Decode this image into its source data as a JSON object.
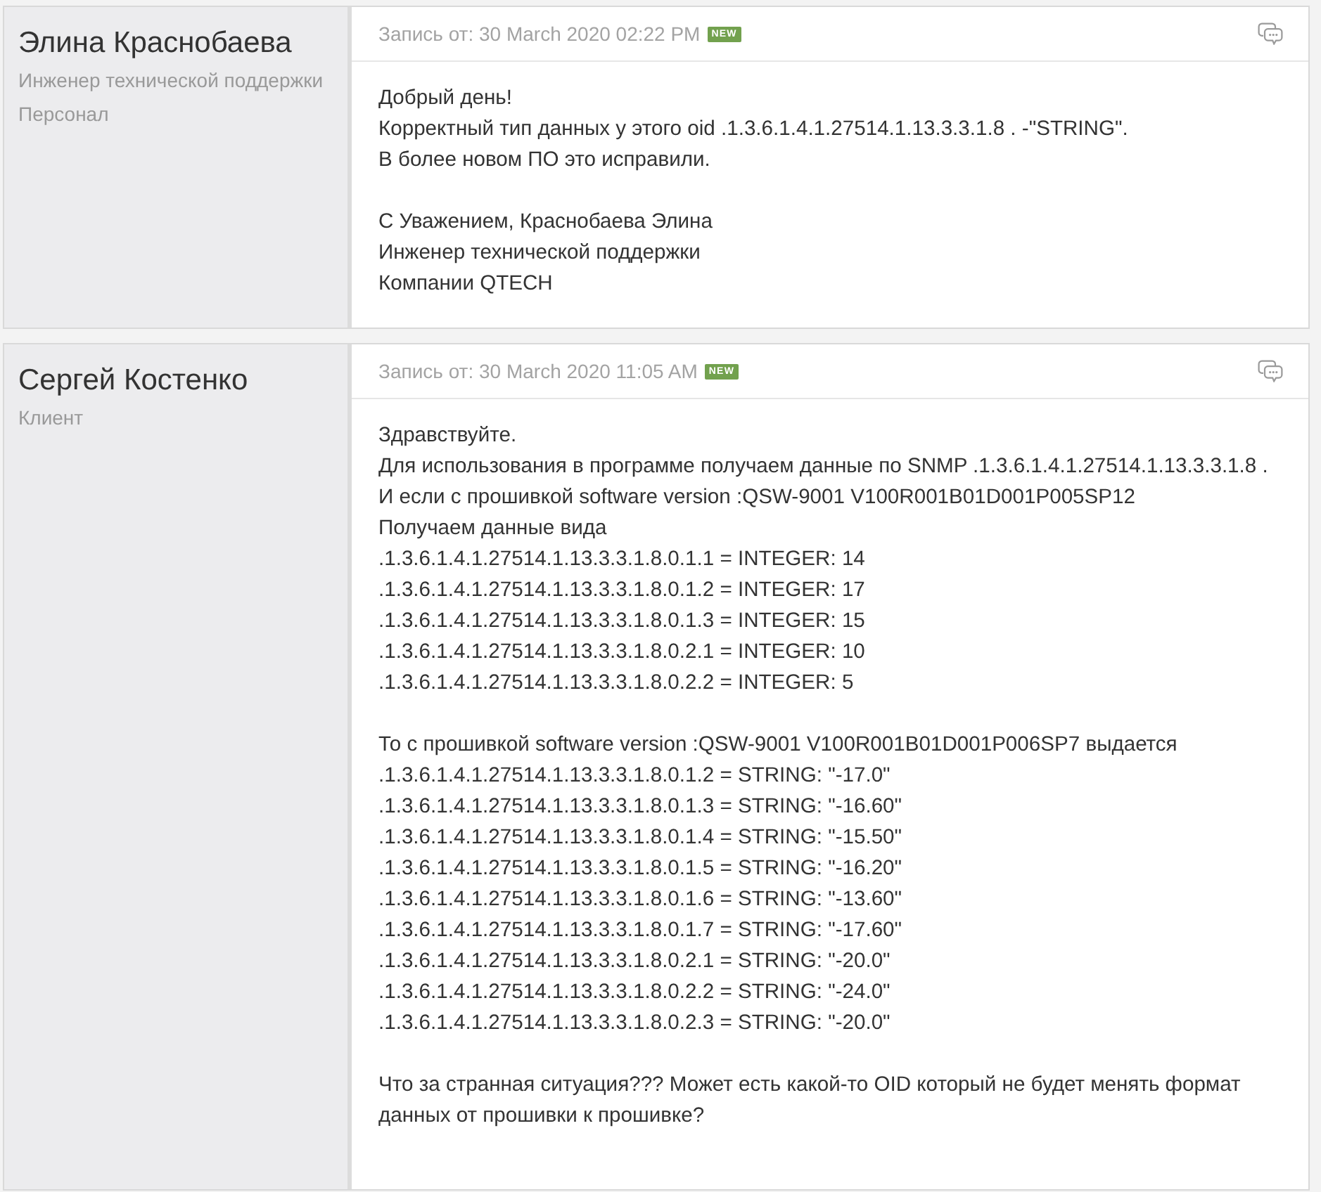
{
  "posts": [
    {
      "author": {
        "name": "Элина Краснобаева",
        "roles": [
          "Инженер технической поддержки",
          "Персонал"
        ]
      },
      "header": {
        "date_label": "Запись от: 30 March 2020 02:22 PM",
        "badge": "NEW"
      },
      "paragraphs": [
        [
          "Добрый день!",
          "Корректный тип данных у этого oid .1.3.6.1.4.1.27514.1.13.3.3.1.8 . -\"STRING\".",
          "В более новом ПО это исправили."
        ],
        [
          "С Уважением, Краснобаева Элина",
          "Инженер технической поддержки",
          "Компании QTECH"
        ]
      ]
    },
    {
      "author": {
        "name": "Сергей Костенко",
        "roles": [
          "Клиент"
        ]
      },
      "header": {
        "date_label": "Запись от: 30 March 2020 11:05 AM",
        "badge": "NEW"
      },
      "paragraphs": [
        [
          "Здравствуйте.",
          "Для использования в программе получаем данные по SNMP .1.3.6.1.4.1.27514.1.13.3.3.1.8 .",
          "И если с прошивкой software version :QSW-9001 V100R001B01D001P005SP12",
          "Получаем данные вида",
          ".1.3.6.1.4.1.27514.1.13.3.3.1.8.0.1.1 = INTEGER: 14",
          ".1.3.6.1.4.1.27514.1.13.3.3.1.8.0.1.2 = INTEGER: 17",
          ".1.3.6.1.4.1.27514.1.13.3.3.1.8.0.1.3 = INTEGER: 15",
          ".1.3.6.1.4.1.27514.1.13.3.3.1.8.0.2.1 = INTEGER: 10",
          ".1.3.6.1.4.1.27514.1.13.3.3.1.8.0.2.2 = INTEGER: 5"
        ],
        [
          "То с прошивкой software version :QSW-9001 V100R001B01D001P006SP7 выдается",
          ".1.3.6.1.4.1.27514.1.13.3.3.1.8.0.1.2 = STRING: \"-17.0\"",
          ".1.3.6.1.4.1.27514.1.13.3.3.1.8.0.1.3 = STRING: \"-16.60\"",
          ".1.3.6.1.4.1.27514.1.13.3.3.1.8.0.1.4 = STRING: \"-15.50\"",
          ".1.3.6.1.4.1.27514.1.13.3.3.1.8.0.1.5 = STRING: \"-16.20\"",
          ".1.3.6.1.4.1.27514.1.13.3.3.1.8.0.1.6 = STRING: \"-13.60\"",
          ".1.3.6.1.4.1.27514.1.13.3.3.1.8.0.1.7 = STRING: \"-17.60\"",
          ".1.3.6.1.4.1.27514.1.13.3.3.1.8.0.2.1 = STRING: \"-20.0\"",
          ".1.3.6.1.4.1.27514.1.13.3.3.1.8.0.2.2 = STRING: \"-24.0\"",
          ".1.3.6.1.4.1.27514.1.13.3.3.1.8.0.2.3 = STRING: \"-20.0\""
        ],
        [
          "Что за странная ситуация??? Может есть какой-то OID который не будет менять формат данных от прошивки к прошивке?"
        ]
      ]
    }
  ]
}
